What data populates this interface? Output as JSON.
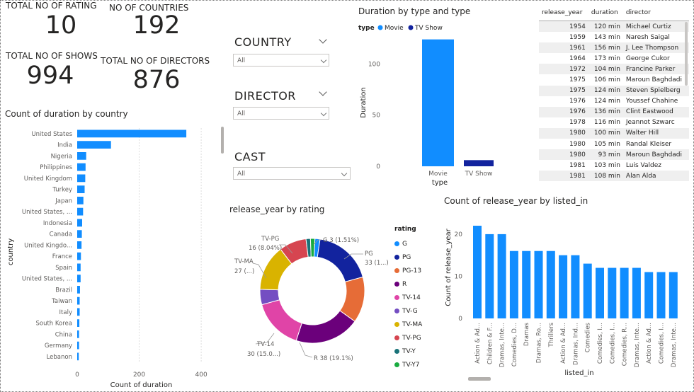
{
  "kpis": {
    "rating": {
      "label": "TOTAL NO OF RATING",
      "value": "10"
    },
    "countries": {
      "label": "NO OF COUNTRIES",
      "value": "192"
    },
    "shows": {
      "label": "TOTAL NO OF SHOWS",
      "value": "994"
    },
    "directors": {
      "label": "TOTAL NO OF DIRECTORS",
      "value": "876"
    }
  },
  "slicers": {
    "country": {
      "title": "COUNTRY",
      "value": "All"
    },
    "director": {
      "title": "DIRECTOR",
      "value": "All"
    },
    "cast": {
      "title": "CAST",
      "value": "All"
    }
  },
  "table": {
    "headers": [
      "release_year",
      "duration",
      "director"
    ],
    "rows": [
      [
        "1954",
        "120 min",
        "Michael Curtiz"
      ],
      [
        "1959",
        "143 min",
        "Naresh Saigal"
      ],
      [
        "1961",
        "156 min",
        "J. Lee Thompson"
      ],
      [
        "1964",
        "173 min",
        "George Cukor"
      ],
      [
        "1972",
        "104 min",
        "Francine Parker"
      ],
      [
        "1975",
        "106 min",
        "Maroun Baghdadi"
      ],
      [
        "1975",
        "124 min",
        "Steven Spielberg"
      ],
      [
        "1976",
        "124 min",
        "Youssef Chahine"
      ],
      [
        "1976",
        "136 min",
        "Clint Eastwood"
      ],
      [
        "1978",
        "116 min",
        "Jeannot Szwarc"
      ],
      [
        "1980",
        "100 min",
        "Walter Hill"
      ],
      [
        "1980",
        "105 min",
        "Randal Kleiser"
      ],
      [
        "1980",
        "93 min",
        "Maroun Baghdadi"
      ],
      [
        "1981",
        "103 min",
        "Luis Valdez"
      ],
      [
        "1981",
        "108 min",
        "Alan Alda"
      ]
    ]
  },
  "colors": {
    "blue": "#118DFF",
    "navy": "#12239E",
    "orange": "#E66C37",
    "purple": "#6B007B",
    "pink": "#E044A7",
    "violet": "#744EC2",
    "yellow": "#D9B300",
    "rose": "#D64550",
    "teal": "#197278",
    "green": "#1AAB40"
  },
  "chart_data": [
    {
      "id": "country",
      "type": "bar",
      "orientation": "horizontal",
      "title": "Count of duration by country",
      "xlabel": "Count of duration",
      "ylabel": "country",
      "xlim": [
        0,
        450
      ],
      "xticks": [
        "0",
        "200",
        "400"
      ],
      "categories": [
        "United States",
        "India",
        "Nigeria",
        "Philippines",
        "United Kingdom",
        "Turkey",
        "Japan",
        "United States, ...",
        "Indonesia",
        "Canada",
        "United Kingdo...",
        "France",
        "Spain",
        "United States, ...",
        "Brazil",
        "Taiwan",
        "Italy",
        "South Korea",
        "China",
        "Germany",
        "Lebanon"
      ],
      "values": [
        352,
        109,
        29,
        27,
        26,
        24,
        20,
        19,
        16,
        15,
        14,
        12,
        11,
        11,
        9,
        8,
        8,
        7,
        6,
        6,
        5
      ]
    },
    {
      "id": "type",
      "type": "bar",
      "title": "Duration by type and type",
      "legend_title": "type",
      "xlabel": "type",
      "ylabel": "Duration",
      "ylim": [
        0,
        130
      ],
      "yticks": [
        "0",
        "50",
        "100"
      ],
      "categories": [
        "Movie",
        "TV Show"
      ],
      "values": [
        124,
        6
      ]
    },
    {
      "id": "rating",
      "type": "pie",
      "title": "release_year by rating",
      "legend_title": "rating",
      "categories": [
        "G",
        "PG",
        "PG-13",
        "R",
        "TV-14",
        "TV-G",
        "TV-MA",
        "TV-PG",
        "TV-Y",
        "TV-Y7"
      ],
      "values": [
        1.51,
        17.5,
        13.5,
        19.1,
        15.0,
        4.5,
        13.5,
        8.04,
        1.3,
        1.3
      ],
      "labels": [
        {
          "name": "PG",
          "text": "33 (1...)"
        },
        {
          "name": "R",
          "text": "R 38 (19.1%)"
        },
        {
          "name": "TV-14",
          "text": "30 (15.0...)"
        },
        {
          "name": "TV-MA",
          "text": "27 (...)"
        },
        {
          "name": "TV-PG",
          "text": "16 (8.04%)"
        },
        {
          "name": "G",
          "text": "G 3 (1.51%)"
        }
      ]
    },
    {
      "id": "listed",
      "type": "bar",
      "title": "Count of release_year by listed_in",
      "xlabel": "listed_in",
      "ylabel": "Count of release_year",
      "ylim": [
        0,
        22
      ],
      "yticks": [
        "0",
        "10",
        "20"
      ],
      "categories": [
        "Action & Ad...",
        "Children & F...",
        "Dramas, Inte...",
        "Comedies, D...",
        "Dramas",
        "Dramas, Ro...",
        "Thrillers",
        "Action & Ad...",
        "Dramas, Ind...",
        "Comedies",
        "Comedies, I...",
        "Comedies, I...",
        "Comedies, R...",
        "Dramas, Inte...",
        "Action & Ad...",
        "Comedies, I...",
        "Dramas, Inte...",
        "Comedies, D..."
      ],
      "values": [
        22,
        20,
        20,
        16,
        16,
        16,
        16,
        15,
        15,
        13,
        12,
        12,
        12,
        12,
        11,
        11,
        11,
        11,
        10
      ]
    }
  ]
}
